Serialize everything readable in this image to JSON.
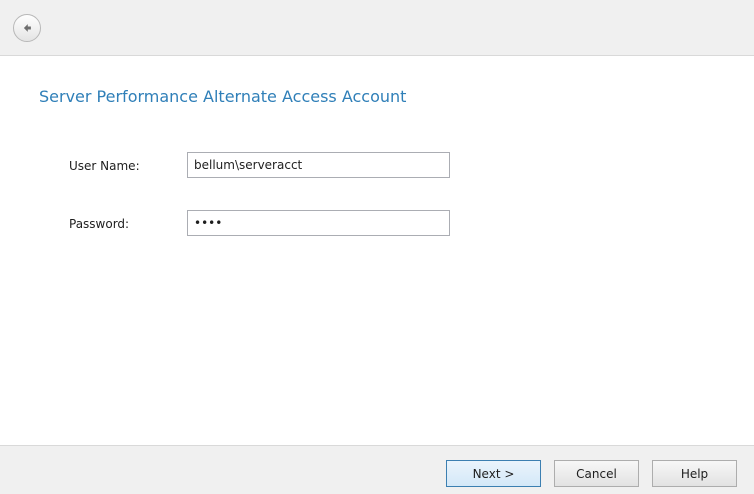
{
  "window": {
    "back_icon": "back-arrow-icon"
  },
  "main": {
    "title": "Server Performance Alternate Access Account",
    "fields": {
      "username": {
        "label": "User Name:",
        "value": "bellum\\serveracct"
      },
      "password": {
        "label": "Password:",
        "value": "••••"
      }
    }
  },
  "footer": {
    "next_label": "Next >",
    "cancel_label": "Cancel",
    "help_label": "Help"
  },
  "colors": {
    "title": "#2f7fb8",
    "bar_background": "#f0f0f0",
    "default_button_border": "#3c7fb1"
  }
}
